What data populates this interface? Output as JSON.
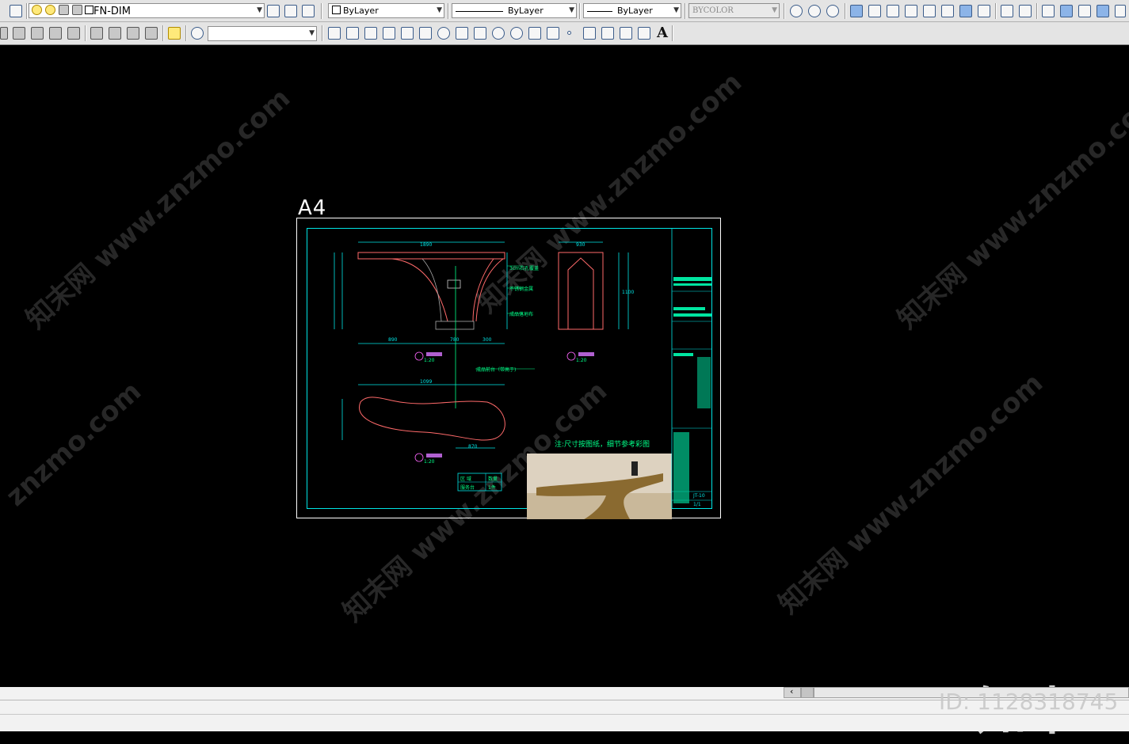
{
  "toolbar_top": {
    "layer_name": "FN-DIM",
    "color_dropdown": "ByLayer",
    "linetype_dropdown": "ByLayer",
    "lineweight_dropdown": "ByLayer",
    "plotstyle_dropdown": "BYCOLOR"
  },
  "toolbar_second": {
    "text_tool_label": "A"
  },
  "drawing": {
    "sheet_label": "A4",
    "note": "注:尺寸按图纸，细节参考彩图",
    "dim_top": "1890",
    "dim_left_pos": "890",
    "dim_mid": "780",
    "dim_right": "300",
    "dim_side_top": "930",
    "dim_side_height": "1100",
    "dim_plan_width": "1099",
    "dim_plan_bottom": "870",
    "scale_1": "1:20",
    "scale_2": "1:20",
    "scale_3": "1:20",
    "label_1": "3cm石孔覆盖",
    "label_2": "不锈钢金属",
    "label_3": "成品落地布",
    "label_4": "成品前台（带高于)",
    "table_head_1": "区  域",
    "table_head_2": "数量",
    "table_cell_1": "服务台",
    "table_cell_2": "1件",
    "title_code": "JT-10",
    "title_page": "1/1"
  },
  "watermark": {
    "text": "知末网 www.znzmo.com",
    "short": "znzmo.com",
    "logo": "知末",
    "id": "ID: 1128318745"
  },
  "colors": {
    "background": "#000000",
    "cad_cyan": "#00e5e5",
    "cad_green": "#00ff88",
    "cad_red": "#ff6a6a",
    "toolbar": "#e4e4e4"
  }
}
